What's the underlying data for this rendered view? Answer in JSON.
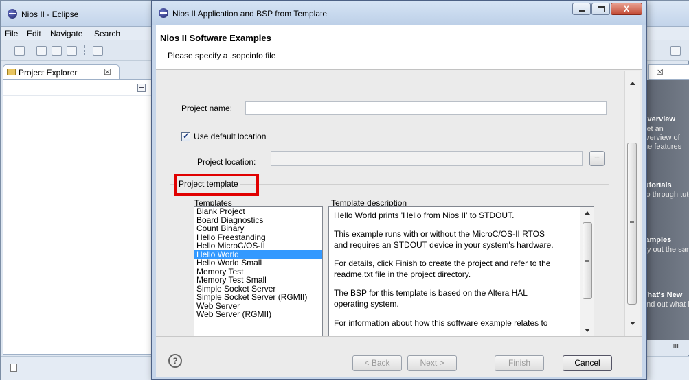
{
  "eclipse": {
    "title": "Nios II - Eclipse",
    "menu": [
      "File",
      "Edit",
      "Navigate",
      "Search"
    ],
    "project_explorer_tab": "Project Explorer",
    "tab_close_glyph": "☒",
    "welcome": {
      "items": [
        {
          "heading": "Overview",
          "sub": "Set an overview of the features"
        },
        {
          "heading": "Tutorials",
          "sub": "Go through tutorials"
        },
        {
          "heading": "Samples",
          "sub": "Try out the samples"
        },
        {
          "heading": "What's New",
          "sub": "Find out what is new"
        }
      ],
      "bottom_glyph": "III"
    }
  },
  "dialog": {
    "title": "Nios II Application and BSP from Template",
    "close_glyph": "X",
    "banner": {
      "heading": "Nios II Software Examples",
      "message": "Please specify a .sopcinfo file"
    },
    "project_name_label": "Project name:",
    "project_name_value": "",
    "use_default_location_label": "Use default location",
    "use_default_location_checked": true,
    "project_location_label": "Project location:",
    "project_location_value": "",
    "browse_label": "...",
    "group_title": "Project template",
    "templates_header": "Templates",
    "description_header": "Template description",
    "templates": [
      "Blank Project",
      "Board Diagnostics",
      "Count Binary",
      "Hello Freestanding",
      "Hello MicroC/OS-II",
      "Hello World",
      "Hello World Small",
      "Memory Test",
      "Memory Test Small",
      "Simple Socket Server",
      "Simple Socket Server (RGMII)",
      "Web Server",
      "Web Server (RGMII)"
    ],
    "selected_template": "Hello World",
    "description_lines": [
      "Hello World prints 'Hello from Nios II' to STDOUT.",
      "This example runs with or without the MicroC/OS-II RTOS",
      "and requires an STDOUT device in your system's hardware.",
      "For details, click Finish to create the project and refer to the",
      "readme.txt file in the project directory.",
      "The BSP for this template is based on the Altera HAL",
      "operating system.",
      "For information about how this software example relates to"
    ],
    "buttons": {
      "help": "?",
      "back": "< Back",
      "next": "Next >",
      "finish": "Finish",
      "cancel": "Cancel"
    },
    "highlight_color": "#e00000"
  }
}
